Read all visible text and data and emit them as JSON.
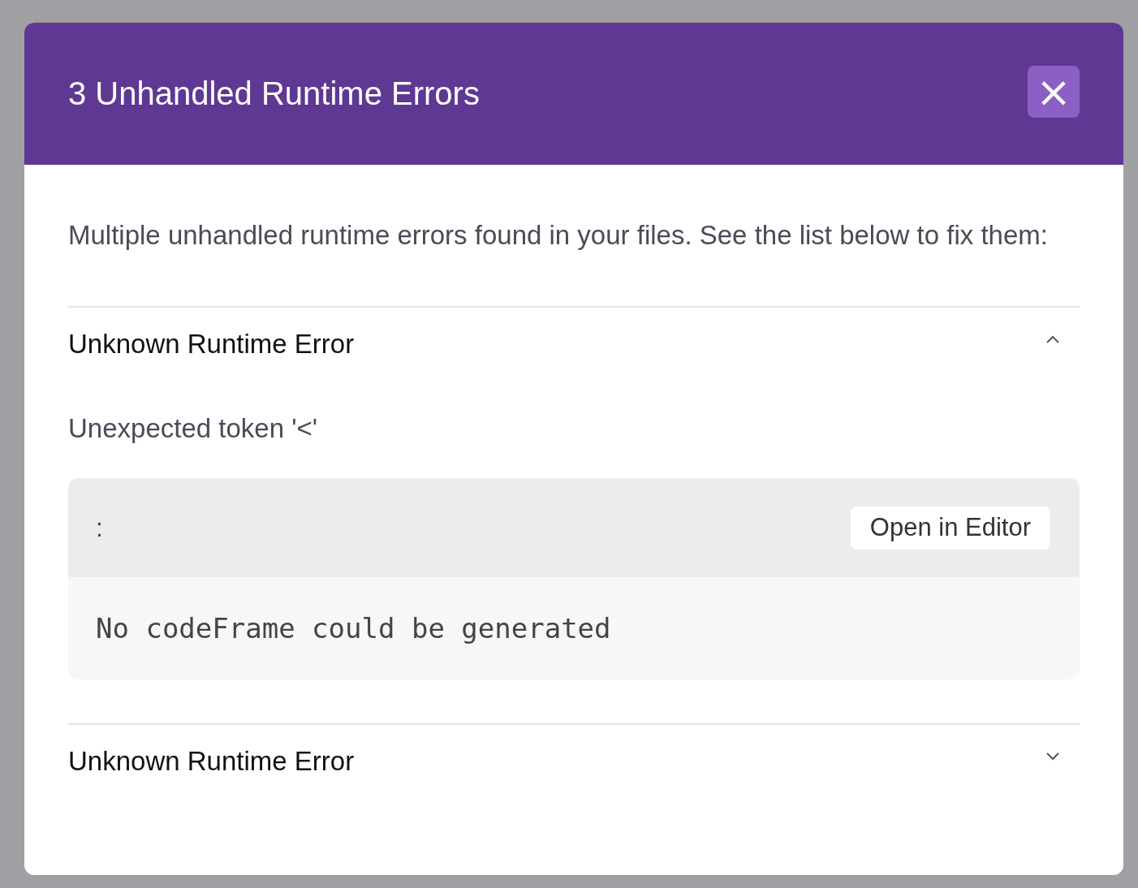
{
  "dialog": {
    "title": "3 Unhandled Runtime Errors",
    "close_label": "×"
  },
  "description": "Multiple unhandled runtime errors found in your files. See the list below to fix them:",
  "errors": [
    {
      "title": "Unknown Runtime Error",
      "expanded": true,
      "message": "Unexpected token '<'",
      "location": ":",
      "open_button": "Open in Editor",
      "code": "No codeFrame could be generated"
    },
    {
      "title": "Unknown Runtime Error",
      "expanded": false
    }
  ]
}
